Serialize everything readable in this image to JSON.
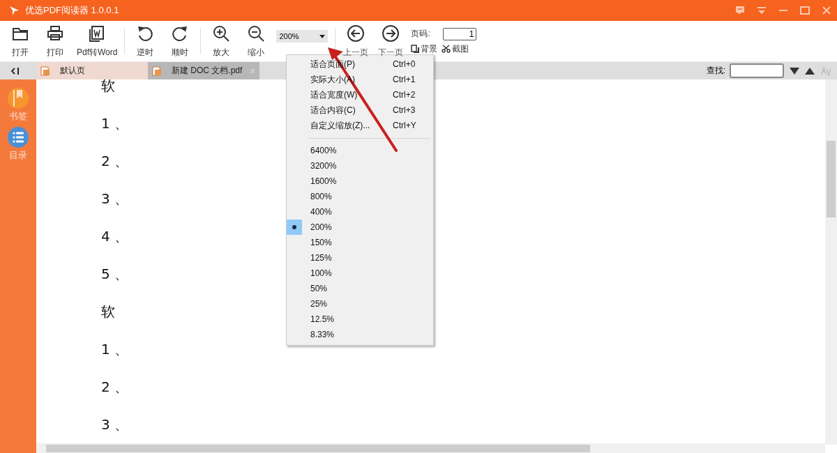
{
  "window": {
    "title": "优选PDF阅读器 1.0.0.1"
  },
  "toolbar": {
    "buttons": [
      {
        "label": "打开"
      },
      {
        "label": "打印"
      },
      {
        "label": "Pdf转Word"
      },
      {
        "label": "逆时"
      },
      {
        "label": "顺时"
      },
      {
        "label": "放大"
      },
      {
        "label": "缩小"
      }
    ],
    "zoom_combo": {
      "value": "200%"
    },
    "nav_buttons": [
      {
        "label": "上一页"
      },
      {
        "label": "下一页"
      }
    ],
    "page_label": "页码:",
    "page_value": "1",
    "background_button": "背景",
    "screenshot_button": "截图"
  },
  "tabs": [
    {
      "label": "默认页",
      "selected": true
    },
    {
      "label": "新建 DOC 文档.pdf",
      "selected": false
    }
  ],
  "search": {
    "label": "查找:"
  },
  "sidebar": {
    "items": [
      {
        "label": "书签"
      },
      {
        "label": "目录"
      }
    ]
  },
  "document": {
    "lines": [
      "软",
      "1 、",
      "2 、",
      "3 、",
      "4 、",
      "5 、",
      "软",
      "1 、",
      "2 、",
      "3 、"
    ]
  },
  "zoom_menu": {
    "commands": [
      {
        "label": "适合页面(P)",
        "shortcut": "Ctrl+0"
      },
      {
        "label": "实际大小(A)",
        "shortcut": "Ctrl+1"
      },
      {
        "label": "适合宽度(W)",
        "shortcut": "Ctrl+2"
      },
      {
        "label": "适合内容(C)",
        "shortcut": "Ctrl+3"
      },
      {
        "label": "自定义缩放(Z)...",
        "shortcut": "Ctrl+Y"
      }
    ],
    "levels": [
      {
        "label": "6400%",
        "selected": false
      },
      {
        "label": "3200%",
        "selected": false
      },
      {
        "label": "1600%",
        "selected": false
      },
      {
        "label": "800%",
        "selected": false
      },
      {
        "label": "400%",
        "selected": false
      },
      {
        "label": "200%",
        "selected": true
      },
      {
        "label": "150%",
        "selected": false
      },
      {
        "label": "125%",
        "selected": false
      },
      {
        "label": "100%",
        "selected": false
      },
      {
        "label": "50%",
        "selected": false
      },
      {
        "label": "25%",
        "selected": false
      },
      {
        "label": "12.5%",
        "selected": false
      },
      {
        "label": "8.33%",
        "selected": false
      }
    ]
  }
}
